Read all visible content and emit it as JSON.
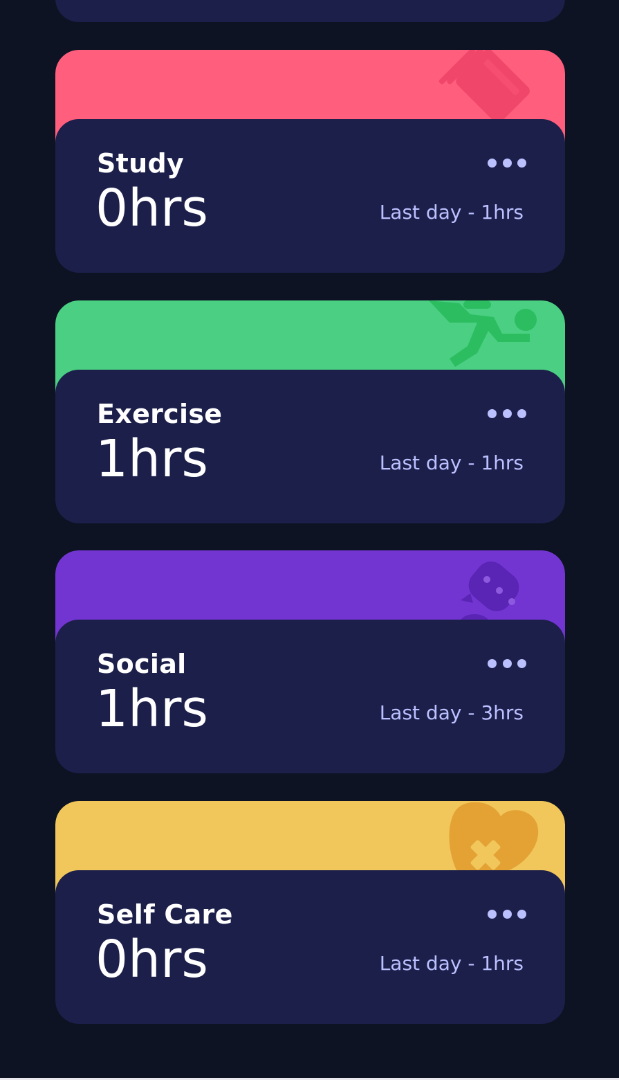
{
  "cards": [
    {
      "title": "Study",
      "current": "0hrs",
      "previous": "Last day - 1hrs",
      "icon": "study-icon",
      "color": "#ff5e7d"
    },
    {
      "title": "Exercise",
      "current": "1hrs",
      "previous": "Last day - 1hrs",
      "icon": "exercise-icon",
      "color": "#4bcf82"
    },
    {
      "title": "Social",
      "current": "1hrs",
      "previous": "Last day - 3hrs",
      "icon": "social-icon",
      "color": "#7335d2"
    },
    {
      "title": "Self Care",
      "current": "0hrs",
      "previous": "Last day - 1hrs",
      "icon": "self-care-icon",
      "color": "#f1c75b"
    }
  ],
  "colors": {
    "background": "#0d1323",
    "card": "#1c1f4a",
    "muted_text": "#bbc0ff"
  }
}
